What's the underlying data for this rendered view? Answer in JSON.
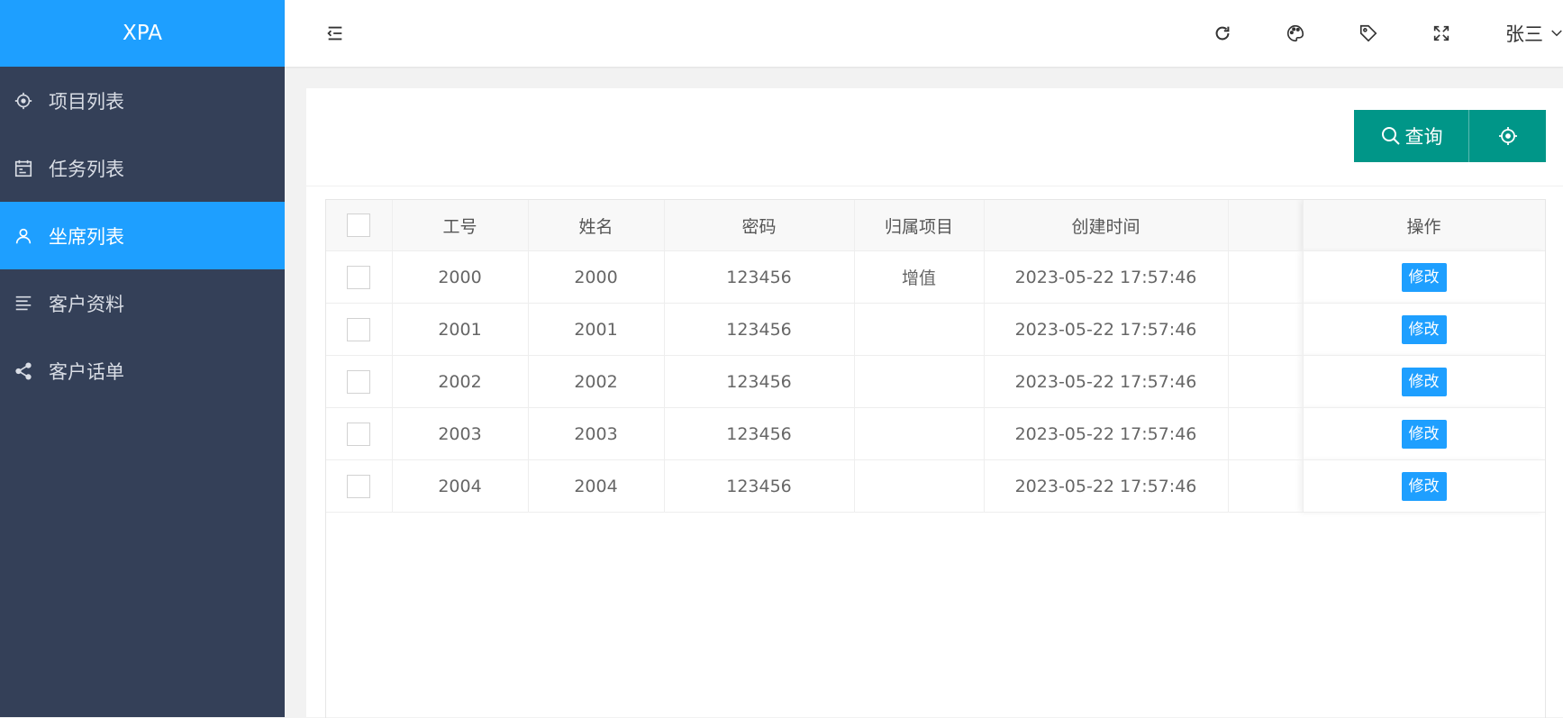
{
  "app": {
    "title": "XPA"
  },
  "sidebar": {
    "items": [
      {
        "label": "项目列表",
        "icon": "settings-icon",
        "active": false
      },
      {
        "label": "任务列表",
        "icon": "calendar-icon",
        "active": false
      },
      {
        "label": "坐席列表",
        "icon": "user-icon",
        "active": true
      },
      {
        "label": "客户资料",
        "icon": "align-icon",
        "active": false
      },
      {
        "label": "客户话单",
        "icon": "share-icon",
        "active": false
      }
    ]
  },
  "header": {
    "icons": [
      "menu-collapse-icon",
      "refresh-icon",
      "palette-icon",
      "tag-icon",
      "fullscreen-icon"
    ],
    "user": "张三"
  },
  "toolbar": {
    "query_label": "查询",
    "reset_icon": "settings-icon"
  },
  "table": {
    "columns": [
      "工号",
      "姓名",
      "密码",
      "归属项目",
      "创建时间",
      "",
      "操作"
    ],
    "rows": [
      {
        "id": "2000",
        "name": "2000",
        "password": "123456",
        "project": "增值",
        "created": "2023-05-22 17:57:46",
        "extra": "",
        "action": "修改"
      },
      {
        "id": "2001",
        "name": "2001",
        "password": "123456",
        "project": "",
        "created": "2023-05-22 17:57:46",
        "extra": "",
        "action": "修改"
      },
      {
        "id": "2002",
        "name": "2002",
        "password": "123456",
        "project": "",
        "created": "2023-05-22 17:57:46",
        "extra": "",
        "action": "修改"
      },
      {
        "id": "2003",
        "name": "2003",
        "password": "123456",
        "project": "",
        "created": "2023-05-22 17:57:46",
        "extra": "",
        "action": "修改"
      },
      {
        "id": "2004",
        "name": "2004",
        "password": "123456",
        "project": "",
        "created": "2023-05-22 17:57:46",
        "extra": "",
        "action": "修改"
      }
    ]
  },
  "colors": {
    "primary": "#1e9fff",
    "sidebar_bg": "#344058",
    "query_button": "#009688"
  }
}
